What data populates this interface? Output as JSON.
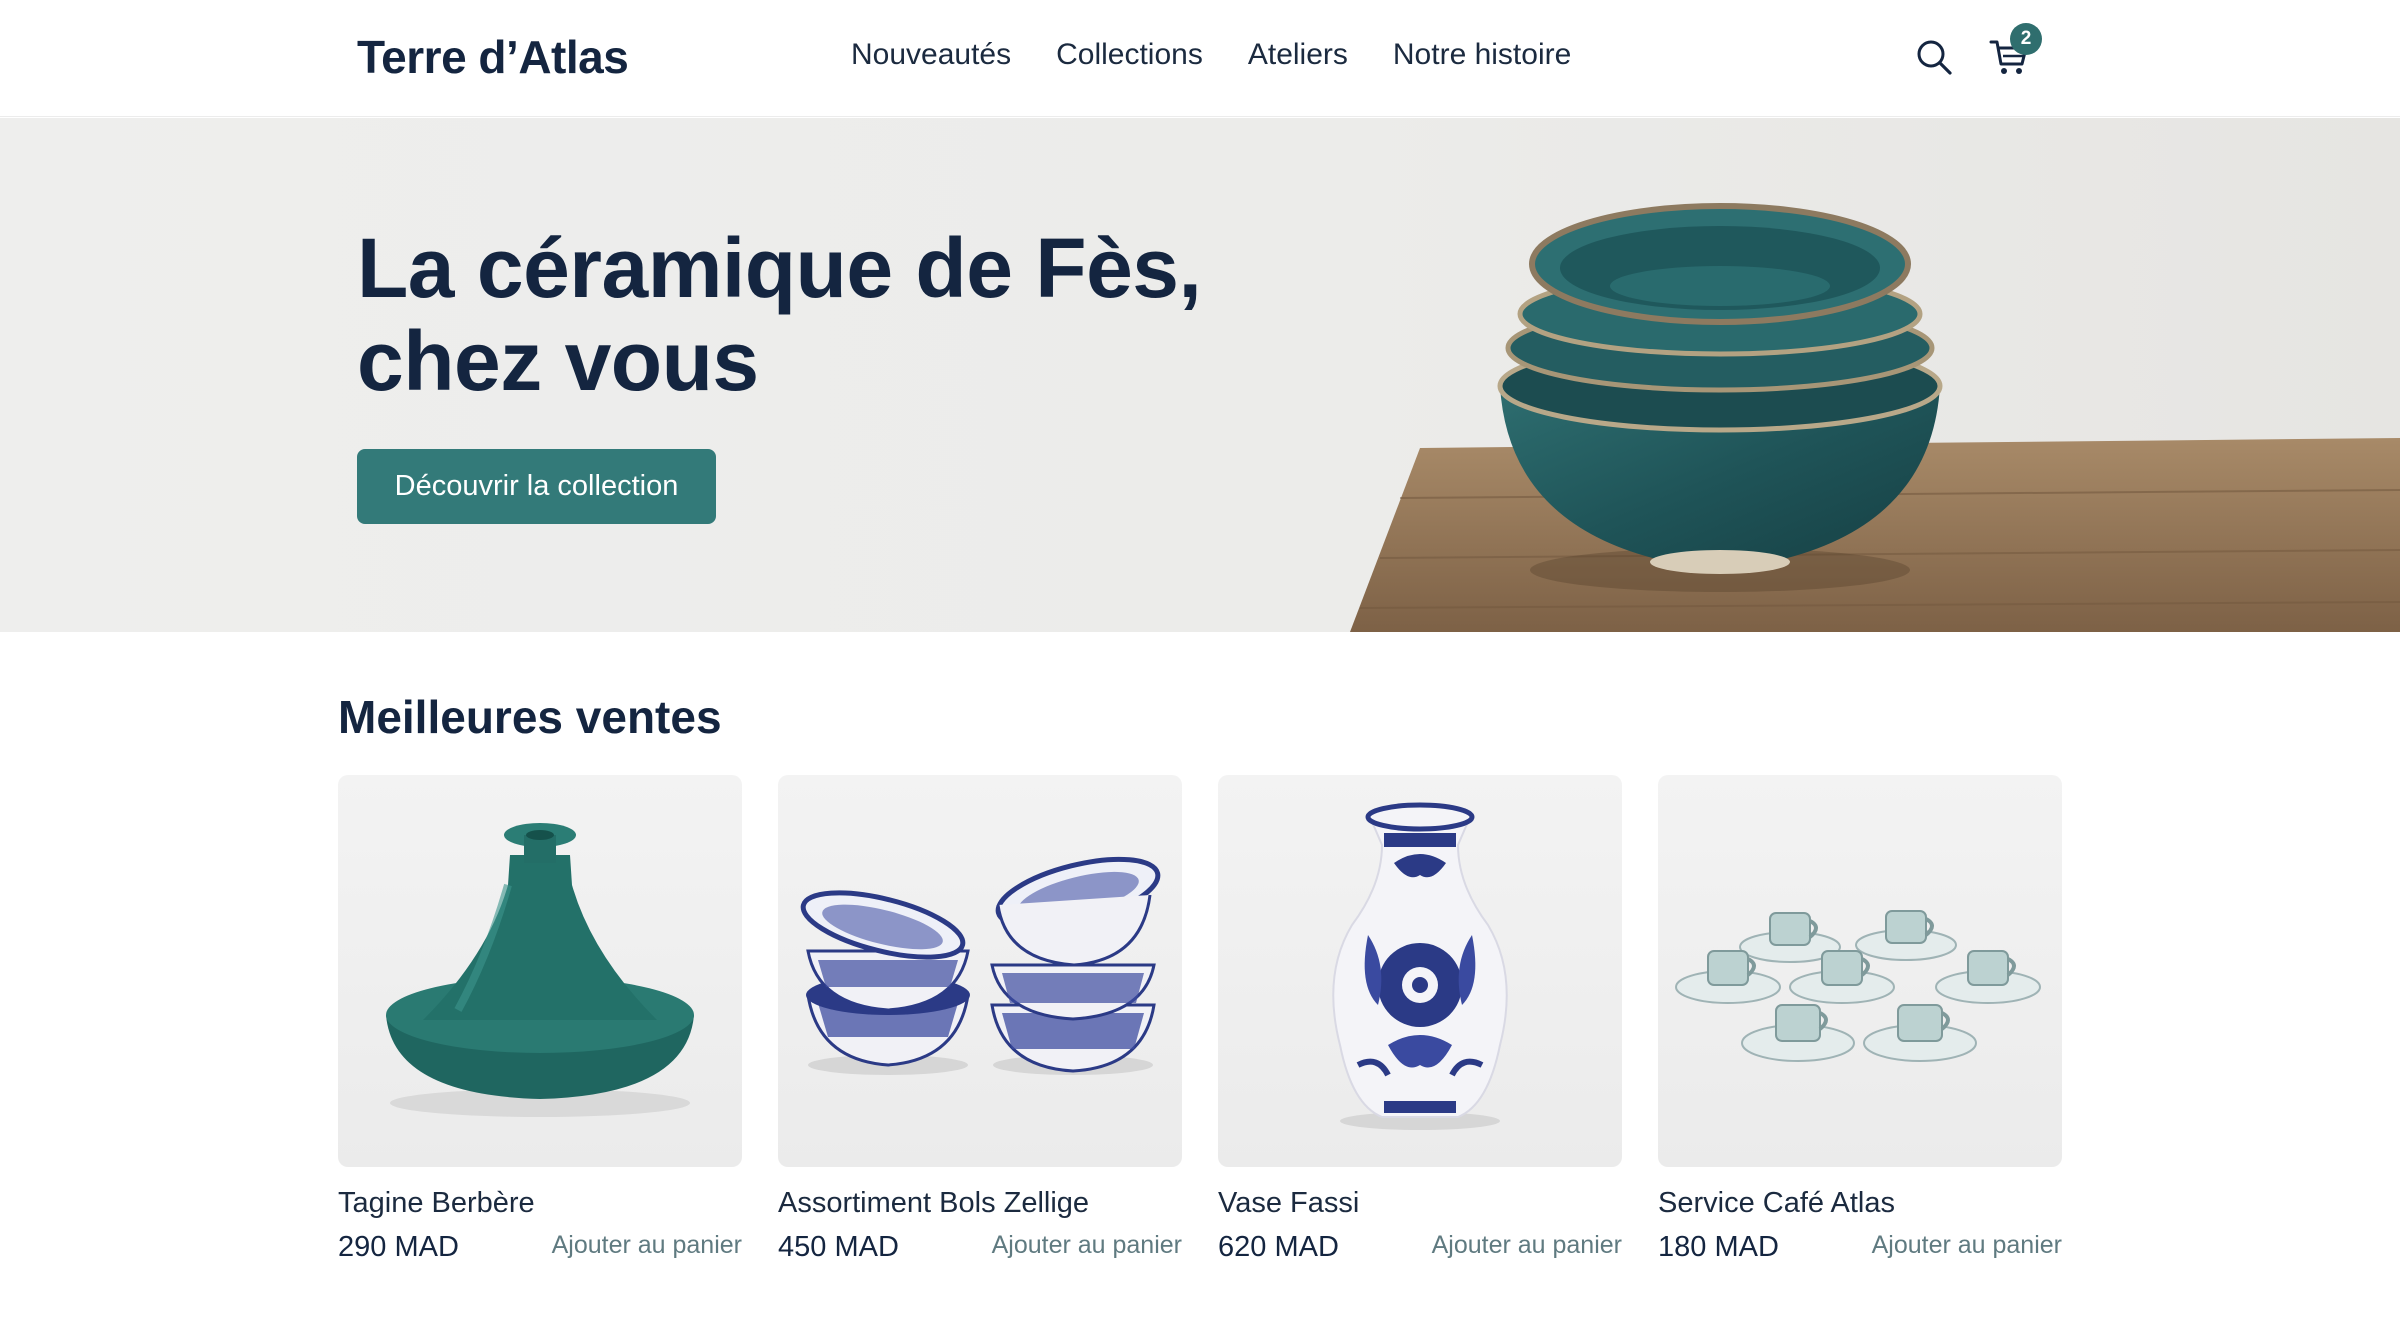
{
  "brand": {
    "name": "Terre d’Atlas"
  },
  "nav": {
    "items": [
      {
        "label": "Nouveautés"
      },
      {
        "label": "Collections"
      },
      {
        "label": "Ateliers"
      },
      {
        "label": "Notre histoire"
      }
    ]
  },
  "header": {
    "search_icon": "search-icon",
    "cart_icon": "cart-icon",
    "cart_count": "2"
  },
  "hero": {
    "title_line1": "La céramique de Fès,",
    "title_line2": "chez vous",
    "cta_label": "Découvrir la collection"
  },
  "bestsellers": {
    "title": "Meilleures ventes",
    "products": [
      {
        "name": "Tagine Berbère",
        "price": "290 MAD",
        "add_label": "Ajouter au panier"
      },
      {
        "name": "Assortiment Bols Zellige",
        "price": "450 MAD",
        "add_label": "Ajouter au panier"
      },
      {
        "name": "Vase Fassi",
        "price": "620 MAD",
        "add_label": "Ajouter au panier"
      },
      {
        "name": "Service Café Atlas",
        "price": "180 MAD",
        "add_label": "Ajouter au panier"
      }
    ]
  },
  "colors": {
    "accent": "#337a79",
    "text": "#142540",
    "badge": "#2f6e6e"
  }
}
